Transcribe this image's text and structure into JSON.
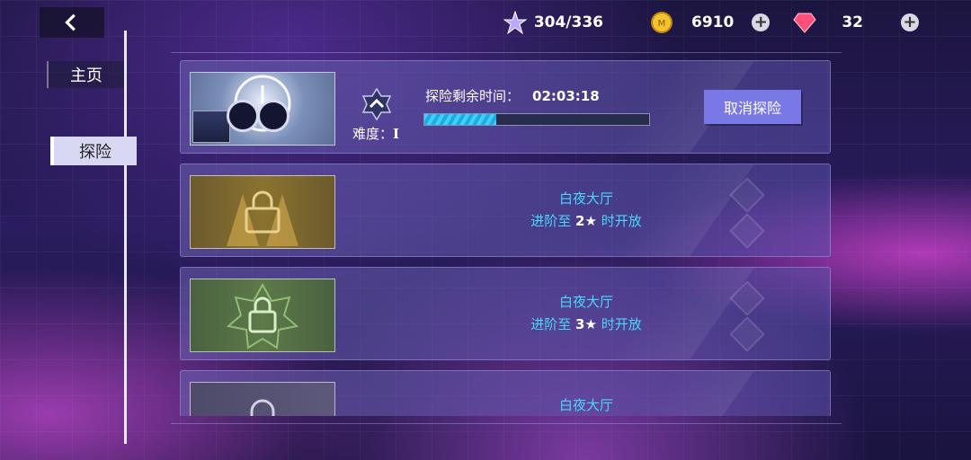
{
  "nav": {
    "back_label": "back",
    "items": [
      {
        "label": "主页",
        "selected": false
      },
      {
        "label": "探险",
        "selected": true
      }
    ]
  },
  "resources": {
    "stamina": "304/336",
    "coins": "6910",
    "crystals": "32"
  },
  "missions": [
    {
      "status": "in_progress",
      "time_label": "探险剩余时间：",
      "time_remaining": "02:03:18",
      "progress": 0.32,
      "difficulty_label": "难度：",
      "difficulty_value": "I",
      "cancel_label": "取消探险"
    },
    {
      "status": "locked",
      "title": "白夜大厅",
      "req_prefix": "进阶至",
      "req_star": "2★",
      "req_suffix": "时开放"
    },
    {
      "status": "locked",
      "title": "白夜大厅",
      "req_prefix": "进阶至",
      "req_star": "3★",
      "req_suffix": "时开放"
    },
    {
      "status": "locked",
      "title": "白夜大厅"
    }
  ],
  "colors": {
    "accent_cyan": "#49d6ff",
    "button": "#7a78e6",
    "nav_selected": "#d8d8f4"
  }
}
